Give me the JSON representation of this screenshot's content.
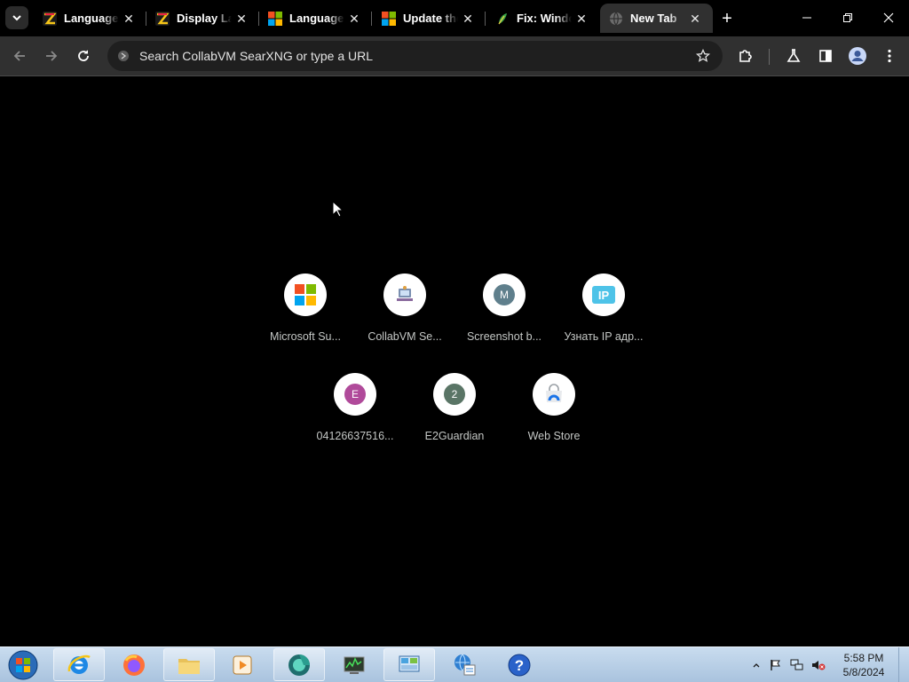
{
  "browser": {
    "tabs": [
      {
        "title": "Language",
        "favicon": "zd-net-icon"
      },
      {
        "title": "Display Language",
        "favicon": "zd-net-icon"
      },
      {
        "title": "Language",
        "favicon": "microsoft-icon"
      },
      {
        "title": "Update the",
        "favicon": "microsoft-icon"
      },
      {
        "title": "Fix: Windows",
        "favicon": "leaf-icon"
      },
      {
        "title": "New Tab",
        "favicon": "globe-icon",
        "active": true
      }
    ],
    "new_tab_label": "+",
    "omnibox": {
      "placeholder": "Search CollabVM SearXNG or type a URL"
    }
  },
  "shortcuts": [
    {
      "label": "Microsoft Su...",
      "icon": "microsoft-logo"
    },
    {
      "label": "CollabVM Se...",
      "icon": "collabvm-logo"
    },
    {
      "label": "Screenshot b...",
      "icon": "letter-m",
      "letter": "M",
      "color": "#5f7f8c"
    },
    {
      "label": "Узнать IP адр...",
      "icon": "ip-logo",
      "letter": "IP"
    },
    {
      "label": "04126637516...",
      "icon": "letter-e",
      "letter": "E",
      "color": "#b04a9a"
    },
    {
      "label": "E2Guardian",
      "icon": "letter-2",
      "letter": "2",
      "color": "#5a7566"
    },
    {
      "label": "Web Store",
      "icon": "web-store-icon"
    }
  ],
  "taskbar": {
    "clock_time": "5:58 PM",
    "clock_date": "5/8/2024",
    "apps": [
      "internet-explorer-icon",
      "firefox-icon",
      "file-explorer-icon",
      "media-player-icon",
      "chrome-like-icon",
      "task-manager-icon",
      "control-panel-icon",
      "network-icon",
      "help-icon"
    ]
  },
  "colors": {
    "accent": "#303030",
    "background": "#000000",
    "taskbar": "#b9d0e8"
  }
}
